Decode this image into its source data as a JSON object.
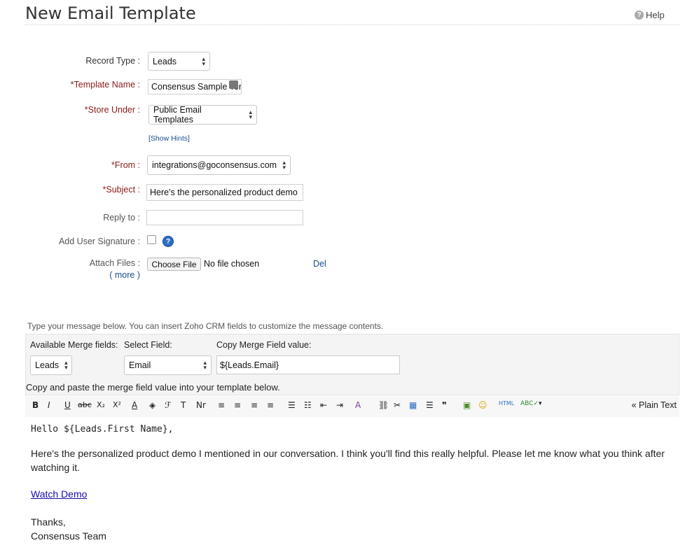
{
  "header": {
    "title": "New Email Template",
    "help_label": "Help"
  },
  "form": {
    "record_type": {
      "label": "Record Type :",
      "value": "Leads"
    },
    "template_name": {
      "req": "*",
      "label": "Template Name :",
      "value": "Consensus Sample Ten"
    },
    "store_under": {
      "req": "*",
      "label": "Store Under :",
      "value": "Public Email Templates"
    },
    "show_hints": "[Show Hints]",
    "from": {
      "req": "*",
      "label": "From :",
      "value": "integrations@goconsensus.com"
    },
    "subject": {
      "req": "*",
      "label": "Subject :",
      "value": "Here's the personalized product demo"
    },
    "reply_to": {
      "label": "Reply to :",
      "value": ""
    },
    "add_signature": {
      "label": "Add User Signature :",
      "checked": false
    },
    "attach": {
      "label": "Attach Files :",
      "more": "( more )",
      "button": "Choose File",
      "status": "No file chosen",
      "del": "Del"
    }
  },
  "merge": {
    "intro": "Type your message below. You can insert Zoho CRM fields to customize the message contents.",
    "available_label": "Available Merge fields:",
    "select_label": "Select Field:",
    "copy_label": "Copy Merge Field value:",
    "available_value": "Leads",
    "select_value": "Email",
    "copy_value": "${Leads.Email}",
    "note": "Copy and paste the merge field value into your template below."
  },
  "toolbar": {
    "plain_text": "« Plain Text"
  },
  "editor": {
    "greeting": "Hello ${Leads.First Name},",
    "body": "Here's the personalized product demo I mentioned in our conversation. I think you'll find this really helpful. Please let me know what you think after watching it.",
    "link": "Watch Demo",
    "thanks": "Thanks,",
    "signoff": "Consensus Team"
  }
}
